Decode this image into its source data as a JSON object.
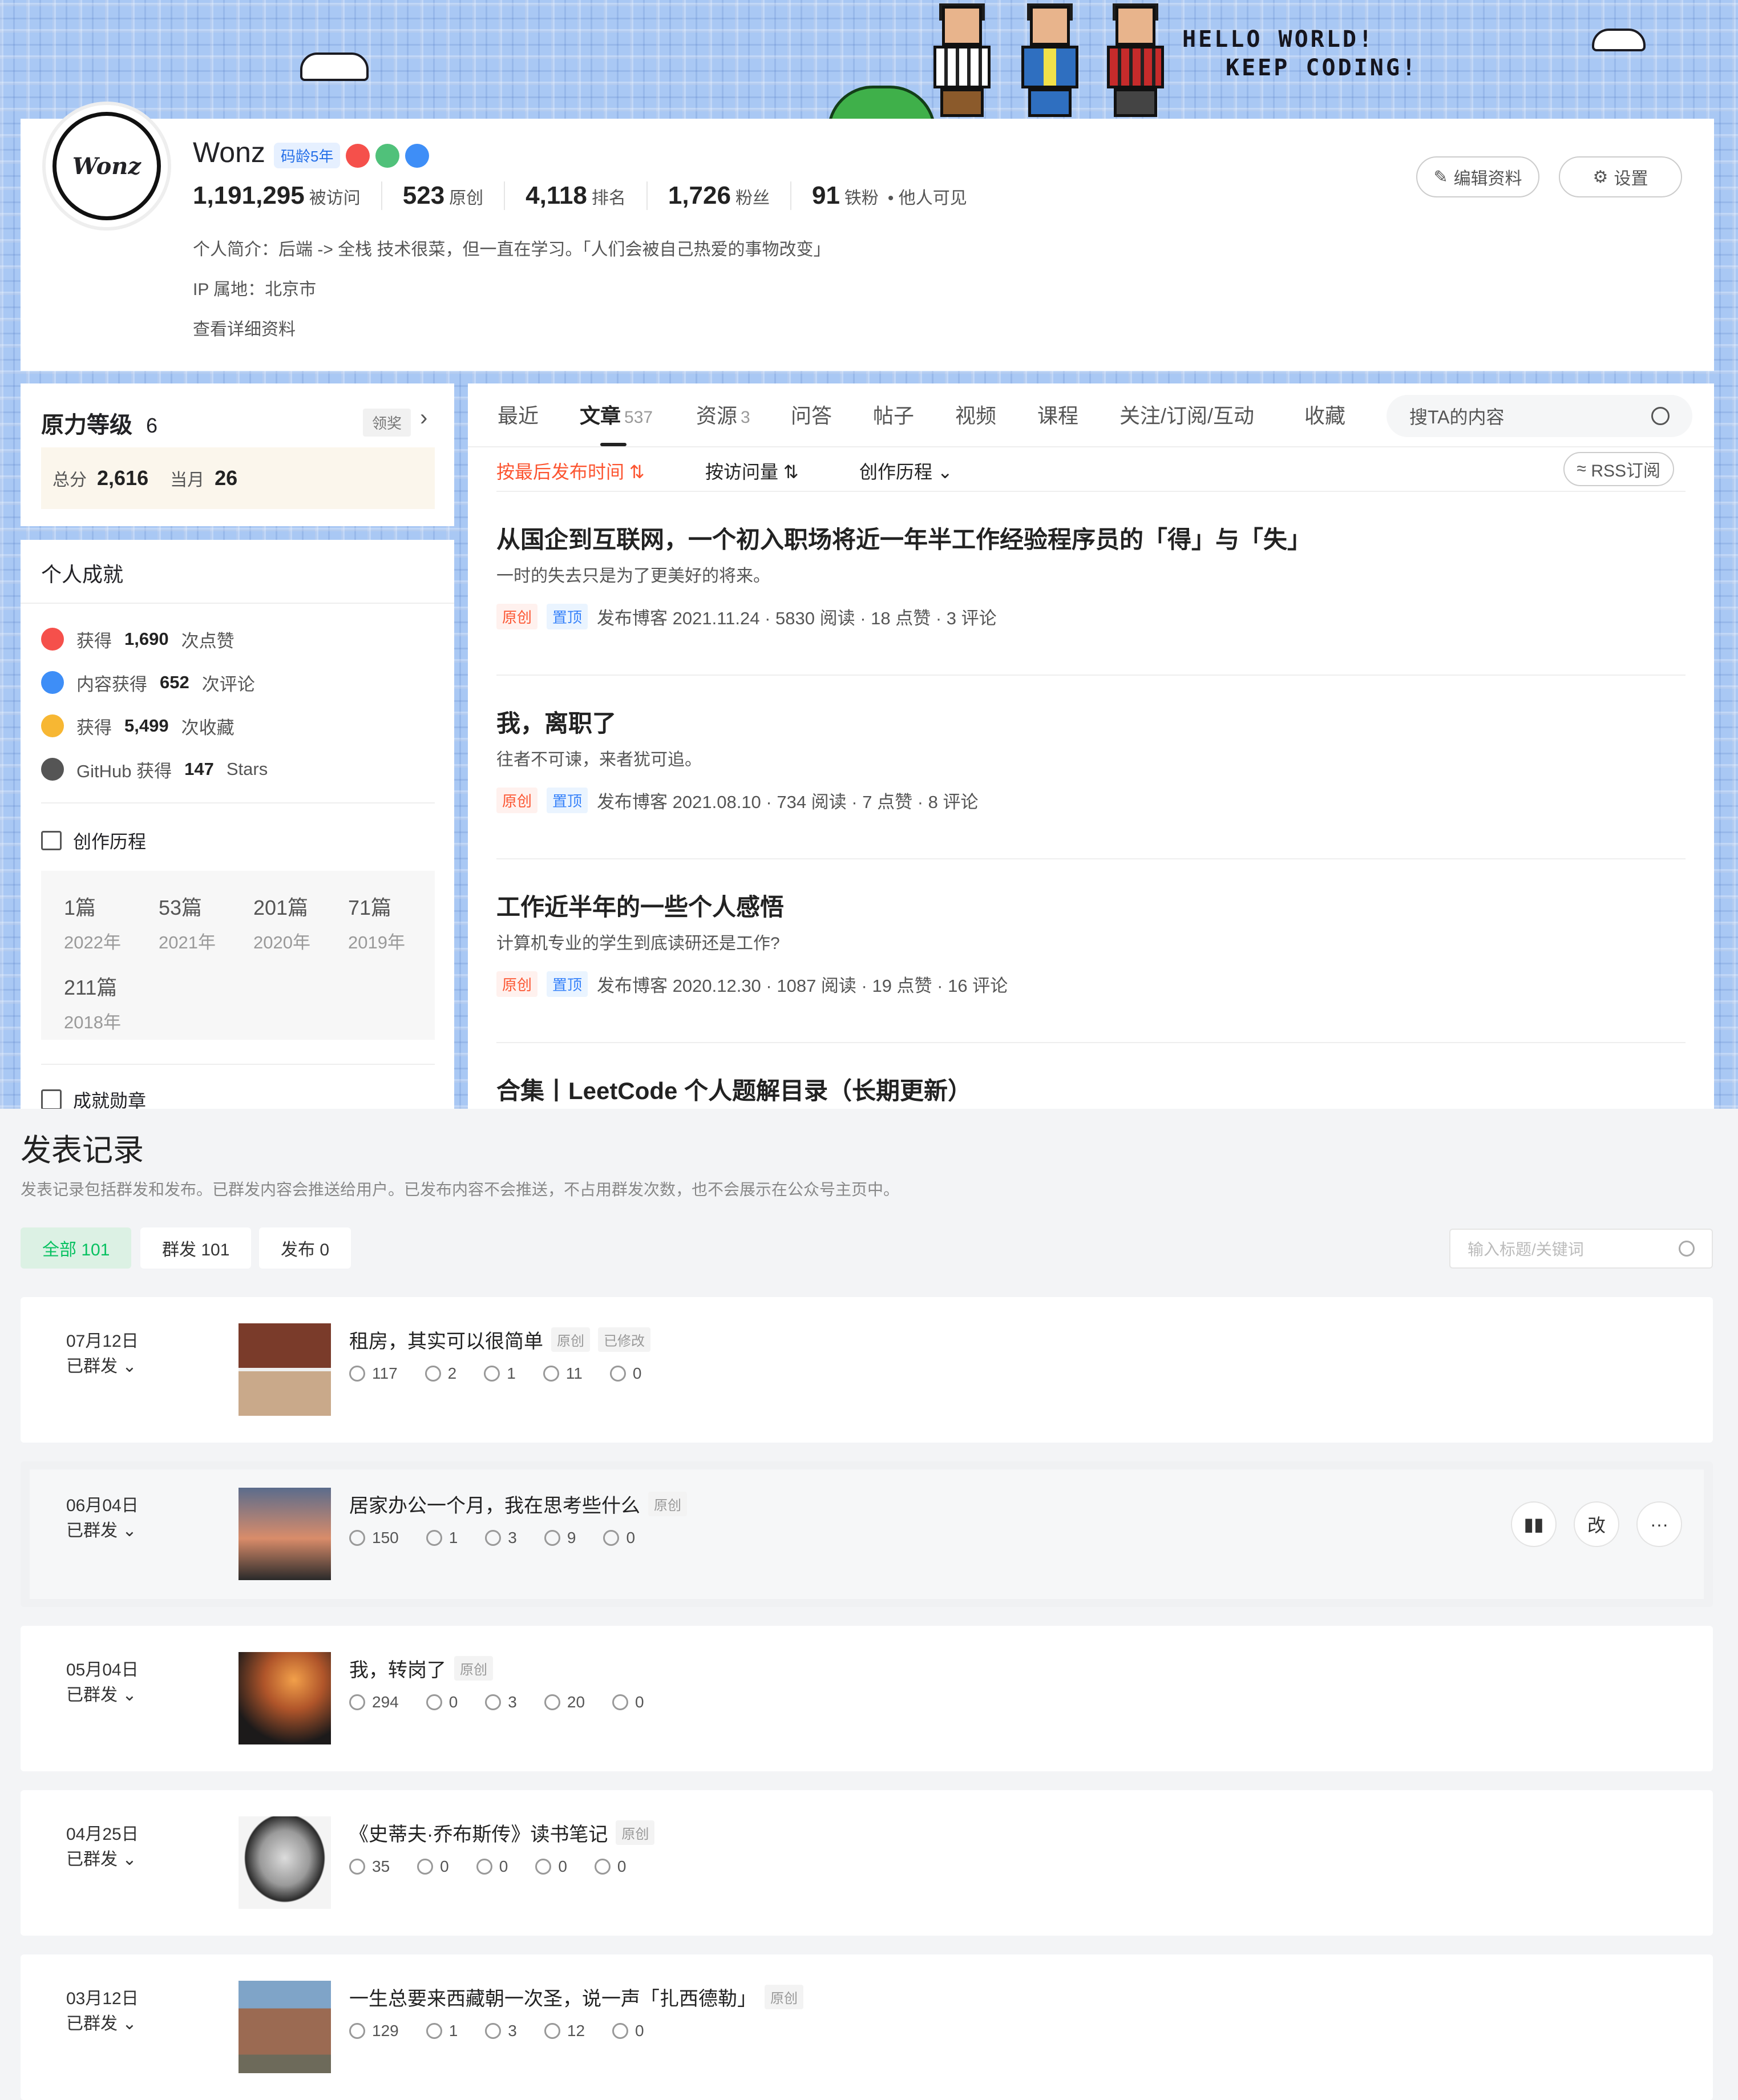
{
  "blog": {
    "banner": {
      "line1": "HELLO WORLD!",
      "line2": "KEEP CODING!"
    },
    "profile": {
      "name": "Wonz",
      "code_age_badge": "码龄5年",
      "stats": [
        {
          "value": "1,191,295",
          "label": "被访问"
        },
        {
          "value": "523",
          "label": "原创"
        },
        {
          "value": "4,118",
          "label": "排名"
        },
        {
          "value": "1,726",
          "label": "粉丝"
        },
        {
          "value": "91",
          "label": "铁粉"
        }
      ],
      "visibility": "• 他人可见",
      "intro": "个人简介：后端 -> 全栈 技术很菜，但一直在学习。「人们会被自己热爱的事物改变」",
      "ip": "IP 属地：北京市",
      "details_link": "查看详细资料",
      "edit_button": "编辑资料",
      "settings_button": "设置"
    },
    "rank_card": {
      "title_a": "原力",
      "title_b": "等级",
      "level": "6",
      "claim": "领奖",
      "total_label": "总分",
      "total": "2,616",
      "month_label": "当月",
      "month": "26"
    },
    "achievements": {
      "title": "个人成就",
      "items": [
        {
          "pre": "获得",
          "num": "1,690",
          "post": "次点赞",
          "color": "#f5504b"
        },
        {
          "pre": "内容获得",
          "num": "652",
          "post": "次评论",
          "color": "#3e8ef7"
        },
        {
          "pre": "获得",
          "num": "5,499",
          "post": "次收藏",
          "color": "#f7b733"
        },
        {
          "pre": "GitHub 获得",
          "num": "147",
          "post": "Stars",
          "color": "#555555"
        }
      ],
      "history_title": "创作历程",
      "years": [
        {
          "count": "1篇",
          "year": "2022年"
        },
        {
          "count": "53篇",
          "year": "2021年"
        },
        {
          "count": "201篇",
          "year": "2020年"
        },
        {
          "count": "71篇",
          "year": "2019年"
        },
        {
          "count": "211篇",
          "year": "2018年"
        }
      ],
      "badges_title": "成就勋章"
    },
    "tabs": [
      {
        "label": "最近",
        "count": ""
      },
      {
        "label": "文章",
        "count": "537"
      },
      {
        "label": "资源",
        "count": "3"
      },
      {
        "label": "问答",
        "count": ""
      },
      {
        "label": "帖子",
        "count": ""
      },
      {
        "label": "视频",
        "count": ""
      },
      {
        "label": "课程",
        "count": ""
      },
      {
        "label": "关注/订阅/互动",
        "count": ""
      },
      {
        "label": "收藏",
        "count": ""
      }
    ],
    "search_placeholder": "搜TA的内容",
    "sort": {
      "by_time": "按最后发布时间",
      "by_views": "按访问量",
      "history": "创作历程",
      "rss": "RSS订阅"
    },
    "articles": [
      {
        "title": "从国企到互联网，一个初入职场将近一年半工作经验程序员的「得」与「失」",
        "desc": "一时的失去只是为了更美好的将来。",
        "tag1": "原创",
        "tag2": "置顶",
        "meta": "发布博客 2021.11.24 · 5830 阅读 · 18 点赞 · 3 评论"
      },
      {
        "title": "我，离职了",
        "desc": "往者不可谏，来者犹可追。",
        "tag1": "原创",
        "tag2": "置顶",
        "meta": "发布博客 2021.08.10 · 734 阅读 · 7 点赞 · 8 评论"
      },
      {
        "title": "工作近半年的一些个人感悟",
        "desc": "计算机专业的学生到底读研还是工作?",
        "tag1": "原创",
        "tag2": "置顶",
        "meta": "发布博客 2020.12.30 · 1087 阅读 · 19 点赞 · 16 评论"
      },
      {
        "title": "合集丨LeetCode 个人题解目录（长期更新）",
        "desc": "",
        "tag1": "",
        "tag2": "",
        "meta": ""
      }
    ]
  },
  "publish": {
    "title": "发表记录",
    "desc": "发表记录包括群发和发布。已群发内容会推送给用户。已发布内容不会推送，不占用群发次数，也不会展示在公众号主页中。",
    "filters": [
      {
        "label": "全部 101",
        "active": true
      },
      {
        "label": "群发 101",
        "active": false
      },
      {
        "label": "发布 0",
        "active": false
      }
    ],
    "search_placeholder": "输入标题/关键词",
    "records": [
      {
        "date": "07月12日",
        "status": "已群发",
        "title": "租房，其实可以很简单",
        "chips": [
          "原创",
          "已修改"
        ],
        "reads": "117",
        "shares": "2",
        "comments": "1",
        "likes": "11",
        "forwards": "0"
      },
      {
        "date": "06月04日",
        "status": "已群发",
        "title": "居家办公一个月，我在思考些什么",
        "chips": [
          "原创"
        ],
        "reads": "150",
        "shares": "1",
        "comments": "3",
        "likes": "9",
        "forwards": "0"
      },
      {
        "date": "05月04日",
        "status": "已群发",
        "title": "我，转岗了",
        "chips": [
          "原创"
        ],
        "reads": "294",
        "shares": "0",
        "comments": "3",
        "likes": "20",
        "forwards": "0"
      },
      {
        "date": "04月25日",
        "status": "已群发",
        "title": "《史蒂夫·乔布斯传》读书笔记",
        "chips": [
          "原创"
        ],
        "reads": "35",
        "shares": "0",
        "comments": "0",
        "likes": "0",
        "forwards": "0"
      },
      {
        "date": "03月12日",
        "status": "已群发",
        "title": "一生总要来西藏朝一次圣，说一声「扎西德勒」",
        "chips": [
          "原创"
        ],
        "reads": "129",
        "shares": "1",
        "comments": "3",
        "likes": "12",
        "forwards": "0"
      }
    ],
    "hover_actions": {
      "edit": "改",
      "more": "···"
    }
  }
}
